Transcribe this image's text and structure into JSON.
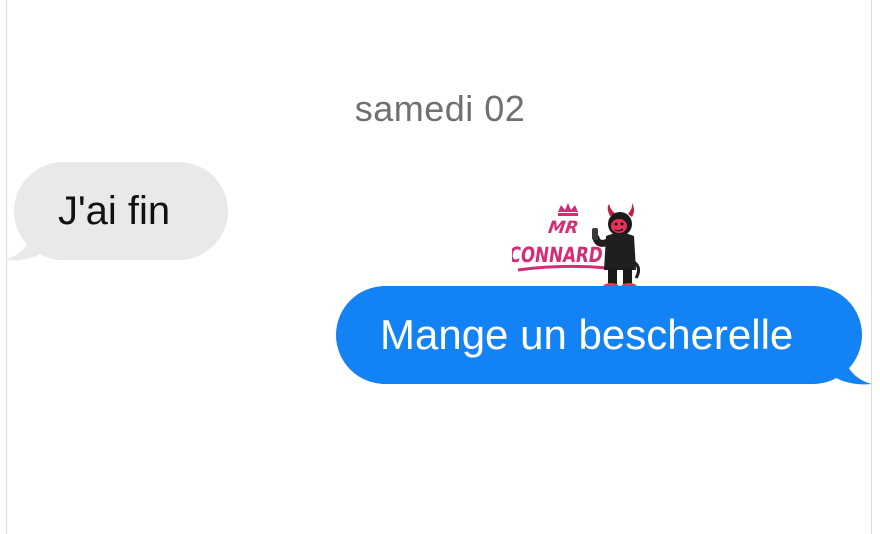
{
  "conversation": {
    "date_label": "samedi 02",
    "messages": [
      {
        "direction": "received",
        "text": "J'ai fin"
      },
      {
        "direction": "sent",
        "text": "Mange un bescherelle"
      }
    ]
  },
  "sticker": {
    "icon": "devil-mascot-icon",
    "logo_text_line1": "MR",
    "logo_text_line2": "CONNARD"
  },
  "colors": {
    "received_bubble": "#e9e9eb",
    "sent_bubble": "#1282f5",
    "date_text": "#707070",
    "sticker_pink": "#d62b77"
  }
}
